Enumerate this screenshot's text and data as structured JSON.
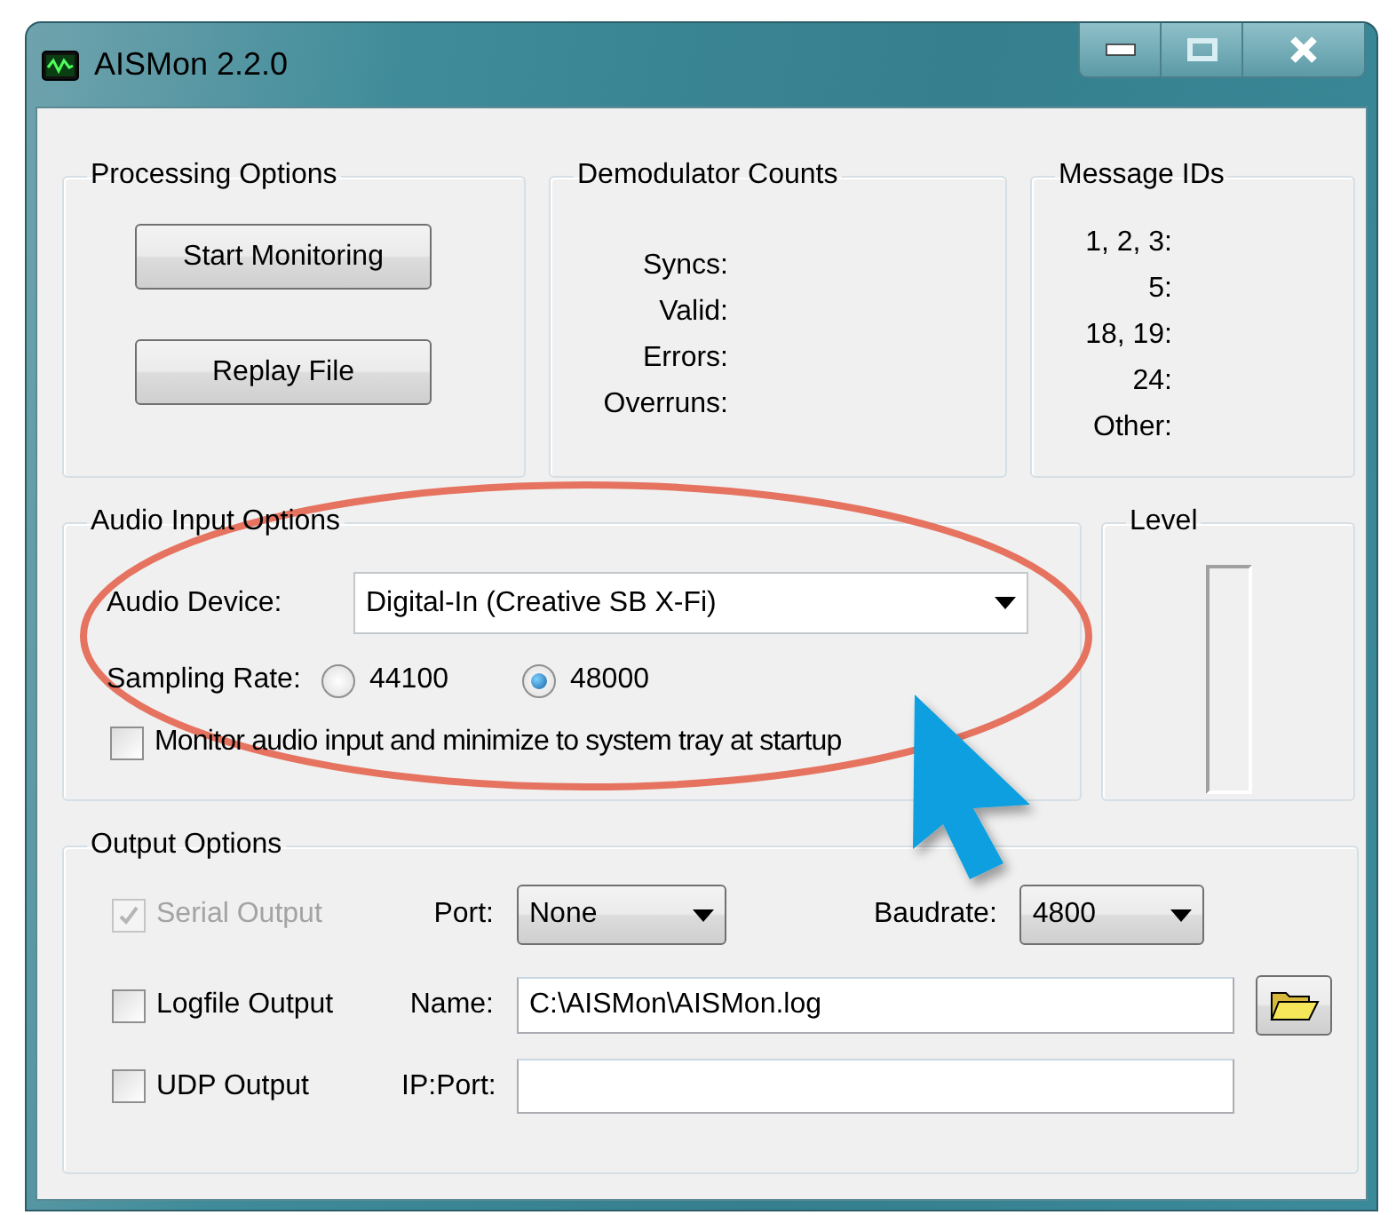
{
  "window": {
    "title": "AISMon 2.2.0"
  },
  "processing_options": {
    "title": "Processing Options",
    "buttons": [
      "Start Monitoring",
      "Replay File"
    ]
  },
  "demodulator_counts": {
    "title": "Demodulator Counts",
    "labels": [
      "Syncs:",
      "Valid:",
      "Errors:",
      "Overruns:"
    ]
  },
  "message_ids": {
    "title": "Message IDs",
    "labels": [
      "1, 2, 3:",
      "5:",
      "18, 19:",
      "24:",
      "Other:"
    ]
  },
  "audio_input_options": {
    "title": "Audio Input Options",
    "audio_device": {
      "label": "Audio Device:",
      "value": "Digital-In (Creative SB X-Fi)"
    },
    "sampling_rate": {
      "label": "Sampling Rate:",
      "options": [
        {
          "label": "44100",
          "selected": false
        },
        {
          "label": "48000",
          "selected": true
        }
      ]
    },
    "monitor_at_startup": {
      "label": "Monitor audio input and minimize to system tray at startup",
      "checked": false
    }
  },
  "level_meter": {
    "title": "Level",
    "level": 0
  },
  "output_options": {
    "title": "Output Options",
    "serial_output": {
      "label": "Serial Output",
      "checked": true,
      "disabled": true,
      "port_label": "Port:",
      "port": "None",
      "baudrate_label": "Baudrate:",
      "baudrate": "4800"
    },
    "logfile_output": {
      "label": "Logfile Output",
      "checked": false,
      "name_label": "Name:",
      "name": "C:\\AISMon\\AISMon.log"
    },
    "udp_output": {
      "label": "UDP Output",
      "checked": false,
      "ip_port_label": "IP:Port:"
    }
  },
  "annotations": [
    {
      "kind": "ellipse",
      "color": "#e5735f"
    },
    {
      "kind": "arrow",
      "color": "#0a9fe0"
    }
  ]
}
